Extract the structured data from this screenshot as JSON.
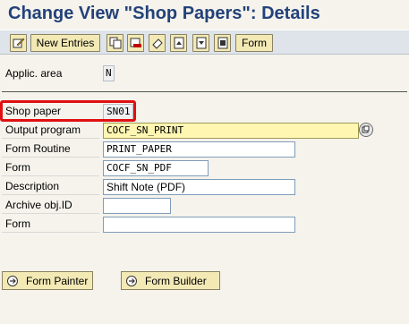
{
  "header": {
    "title": "Change View \"Shop Papers\": Details"
  },
  "toolbar": {
    "new_entries_label": "New Entries",
    "form_label": "Form",
    "icons": [
      "edit-icon",
      "copy-icon",
      "delete-icon",
      "undo-icon",
      "first-entry-icon",
      "previous-entry-icon",
      "next-entry-icon"
    ]
  },
  "fields": {
    "applic_area": {
      "label": "Applic. area",
      "value": "N"
    },
    "shop_paper": {
      "label": "Shop paper",
      "value": "SN01"
    },
    "output_program": {
      "label": "Output program",
      "value": "COCF_SN_PRINT"
    },
    "form_routine": {
      "label": "Form Routine",
      "value": "PRINT_PAPER"
    },
    "form": {
      "label": "Form",
      "value": "COCF_SN_PDF"
    },
    "description": {
      "label": "Description",
      "value": "Shift Note (PDF)"
    },
    "archive_obj_id": {
      "label": "Archive obj.ID",
      "value": ""
    },
    "form2": {
      "label": "Form",
      "value": ""
    }
  },
  "buttons": {
    "form_painter": "Form Painter",
    "form_builder": "Form Builder"
  },
  "colors": {
    "title": "#23427a",
    "highlight": "#e01010",
    "focus_field": "#fff6b2"
  }
}
